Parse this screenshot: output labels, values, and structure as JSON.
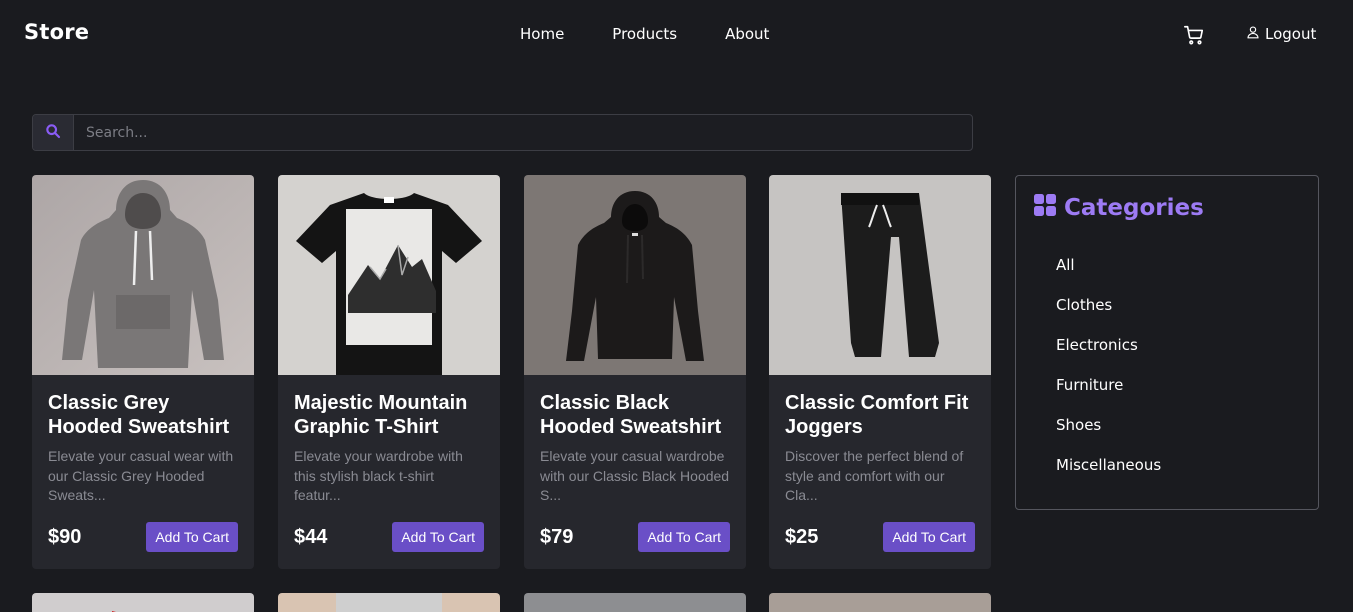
{
  "nav": {
    "brand": "Store",
    "links": [
      "Home",
      "Products",
      "About"
    ],
    "cart_icon": "cart-icon",
    "logout_label": "Logout",
    "user_icon": "user-icon"
  },
  "search": {
    "placeholder": "Search...",
    "value": "",
    "icon": "search-icon"
  },
  "products": [
    {
      "title": "Classic Grey Hooded Sweatshirt",
      "description": "Elevate your casual wear with our Classic Grey Hooded Sweats...",
      "price": "$90",
      "button": "Add To Cart"
    },
    {
      "title": "Majestic Mountain Graphic T-Shirt",
      "description": "Elevate your wardrobe with this stylish black t-shirt featur...",
      "price": "$44",
      "button": "Add To Cart"
    },
    {
      "title": "Classic Black Hooded Sweatshirt",
      "description": "Elevate your casual wardrobe with our Classic Black Hooded S...",
      "price": "$79",
      "button": "Add To Cart"
    },
    {
      "title": "Classic Comfort Fit Joggers",
      "description": "Discover the perfect blend of style and comfort with our Cla...",
      "price": "$25",
      "button": "Add To Cart"
    }
  ],
  "categories": {
    "title": "Categories",
    "icon": "grid-icon",
    "items": [
      "All",
      "Clothes",
      "Electronics",
      "Furniture",
      "Shoes",
      "Miscellaneous"
    ]
  },
  "colors": {
    "background": "#1a1b1f",
    "card": "#26272d",
    "accent": "#6a4fc7",
    "category_accent": "#9d7bf4"
  }
}
